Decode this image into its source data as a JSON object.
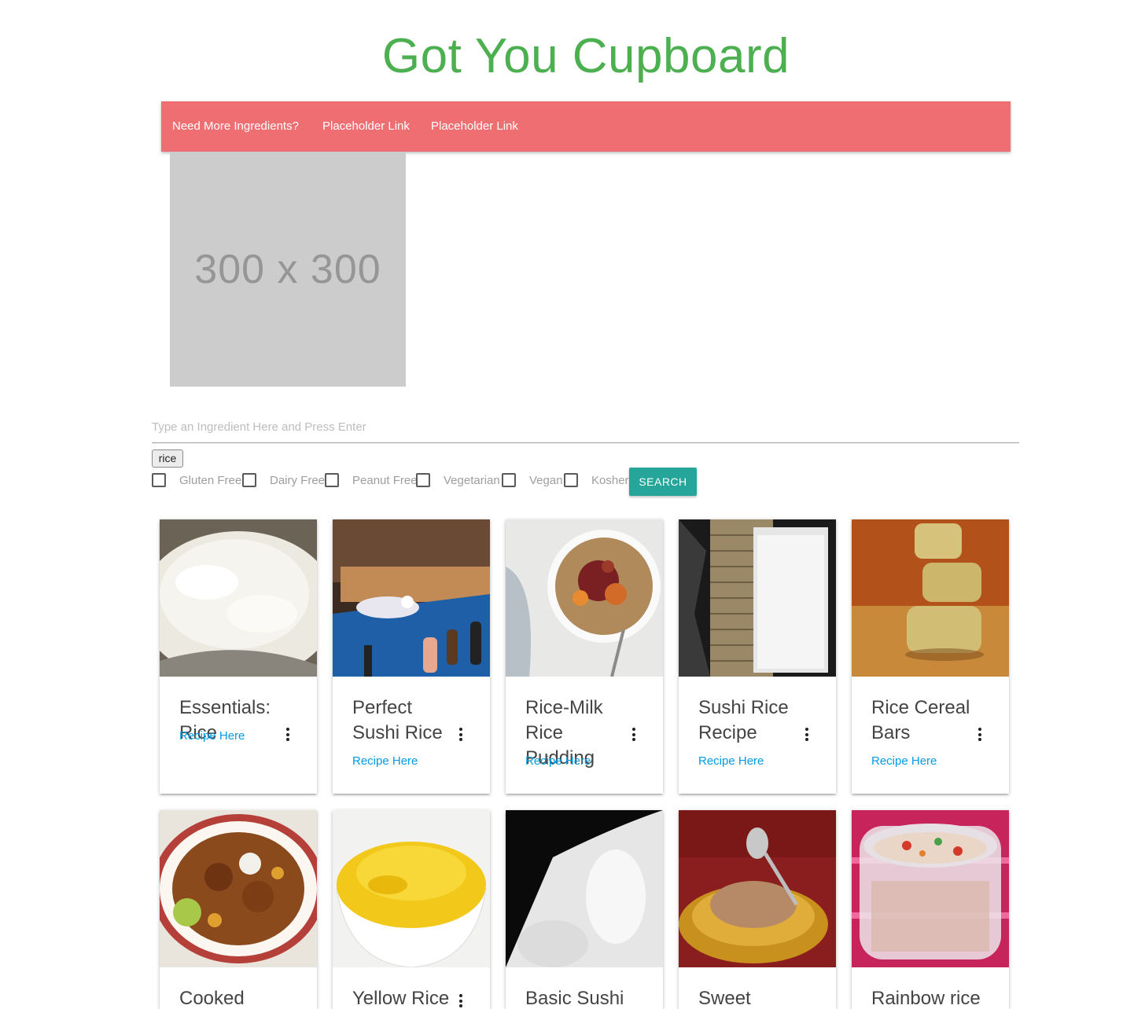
{
  "header": {
    "title": "Got You Cupboard"
  },
  "nav": {
    "links": [
      "Need More Ingredients?",
      "Placeholder Link",
      "Placeholder Link"
    ]
  },
  "placeholder_image": {
    "label": "300 x 300"
  },
  "search": {
    "placeholder": "Type an Ingredient Here and Press Enter",
    "value": "",
    "chips": [
      "rice"
    ],
    "button_label": "Search"
  },
  "filters": [
    {
      "label": "Gluten Free",
      "checked": false
    },
    {
      "label": "Dairy Free",
      "checked": false
    },
    {
      "label": "Peanut Free",
      "checked": false
    },
    {
      "label": "Vegetarian",
      "checked": false
    },
    {
      "label": "Vegan",
      "checked": false
    },
    {
      "label": "Kosher",
      "checked": false
    }
  ],
  "recipes": [
    {
      "title": "Essentials: Rice",
      "link_label": "Recipe Here",
      "image": "white-rice-pot"
    },
    {
      "title": "Perfect Sushi Rice",
      "link_label": "Recipe Here",
      "image": "sushi-kitchen"
    },
    {
      "title": "Rice-Milk Rice Pudding",
      "link_label": "Recipe Here",
      "image": "rice-pudding-bowl"
    },
    {
      "title": "Sushi Rice Recipe",
      "link_label": "Recipe Here",
      "image": "sushi-mat"
    },
    {
      "title": "Rice Cereal Bars",
      "link_label": "Recipe Here",
      "image": "cereal-bars-stack"
    },
    {
      "title": "Cooked",
      "link_label": "",
      "image": "curry-plate"
    },
    {
      "title": "Yellow Rice",
      "link_label": "",
      "image": "yellow-rice-bowl"
    },
    {
      "title": "Basic Sushi",
      "link_label": "",
      "image": "rice-spoon"
    },
    {
      "title": "Sweet",
      "link_label": "",
      "image": "sweet-rice-bowl"
    },
    {
      "title": "Rainbow rice",
      "link_label": "",
      "image": "rainbow-rice-container"
    }
  ],
  "colors": {
    "title": "#4caf50",
    "navbar": "#ef6e72",
    "search_button": "#26a69a",
    "link": "#039be5"
  }
}
